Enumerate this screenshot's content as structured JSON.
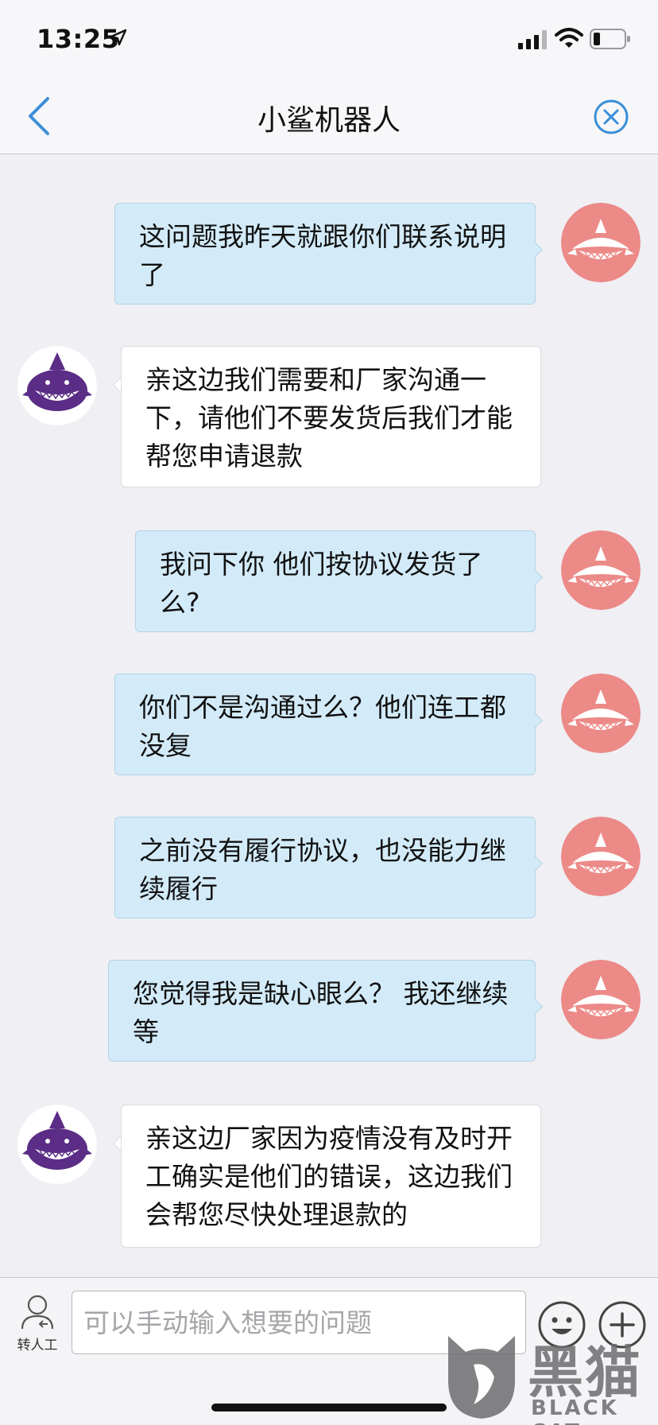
{
  "status_bar": {
    "time": "13:25",
    "icons": [
      "location-arrow-icon",
      "cellular-signal-icon",
      "wifi-icon",
      "battery-icon"
    ]
  },
  "nav": {
    "title": "小鲨机器人",
    "back_icon": "chevron-left-icon",
    "close_icon": "close-circle-icon"
  },
  "messages": [
    {
      "sender": "user",
      "text": "这问题我昨天就跟你们联系说明了"
    },
    {
      "sender": "bot",
      "text": "亲这边我们需要和厂家沟通一下，请他们不要发货后我们才能帮您申请退款"
    },
    {
      "sender": "user",
      "text": "我问下你 他们按协议发货了么?"
    },
    {
      "sender": "user",
      "text": "你们不是沟通过么？他们连工都没复"
    },
    {
      "sender": "user",
      "text": "之前没有履行协议，也没能力继续履行"
    },
    {
      "sender": "user",
      "text": "您觉得我是缺心眼么？ 我还继续等"
    },
    {
      "sender": "bot",
      "text": "亲这边厂家因为疫情没有及时开工确实是他们的错误，这边我们会帮您尽快处理退款的"
    }
  ],
  "input": {
    "transfer_label": "转人工",
    "placeholder": "可以手动输入想要的问题",
    "value": ""
  },
  "watermark": {
    "cn": "黑猫",
    "en": "BLACK CAT"
  },
  "colors": {
    "user_bubble": "#d3ebf9",
    "bot_bubble": "#ffffff",
    "user_avatar": "#ec8a88",
    "bot_avatar": "#5b2d86",
    "accent": "#3b8fd8"
  }
}
